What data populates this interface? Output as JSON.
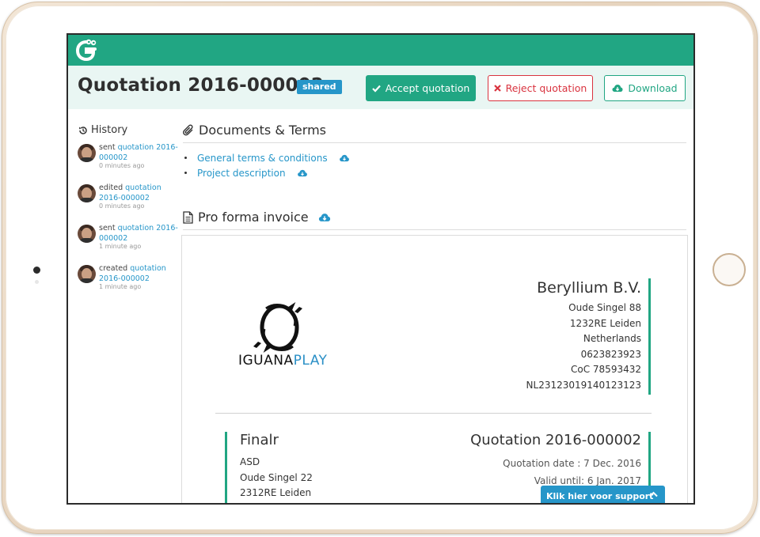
{
  "header": {
    "title": "Quotation 2016-000002",
    "badge": "shared",
    "accept_label": "Accept quotation",
    "reject_label": "Reject quotation",
    "download_label": "Download"
  },
  "history": {
    "title": "History",
    "items": [
      {
        "action": "sent",
        "link": "quotation 2016-000002",
        "time": "0 minutes ago"
      },
      {
        "action": "edited",
        "link": "quotation 2016-000002",
        "time": "0 minutes ago"
      },
      {
        "action": "sent",
        "link": "quotation 2016-000002",
        "time": "1 minute ago"
      },
      {
        "action": "created",
        "link": "quotation 2016-000002",
        "time": "1 minute ago"
      }
    ]
  },
  "documents": {
    "title": "Documents & Terms",
    "items": [
      "General terms & conditions",
      "Project description"
    ]
  },
  "invoice": {
    "title": "Pro forma invoice",
    "logo_text_a": "IGUANA",
    "logo_text_b": "PLAY",
    "company": {
      "name": "Beryllium B.V.",
      "lines": [
        "Oude Singel 88",
        "1232RE Leiden",
        "Netherlands",
        "0623823923",
        "CoC 78593432",
        "NL23123019140123123"
      ]
    },
    "client": {
      "name": "Finalr",
      "lines": [
        "ASD",
        "Oude Singel 22",
        "2312RE Leiden"
      ]
    },
    "quote": {
      "name": "Quotation 2016-000002",
      "date": "Quotation date : 7 Dec. 2016",
      "valid": "Valid until: 6 Jan. 2017"
    }
  },
  "support": {
    "label": "Klik hier voor support"
  },
  "colors": {
    "brand": "#21a683",
    "link": "#2696c9",
    "reject": "#d9333f",
    "header_bg": "#e9f6f3"
  }
}
